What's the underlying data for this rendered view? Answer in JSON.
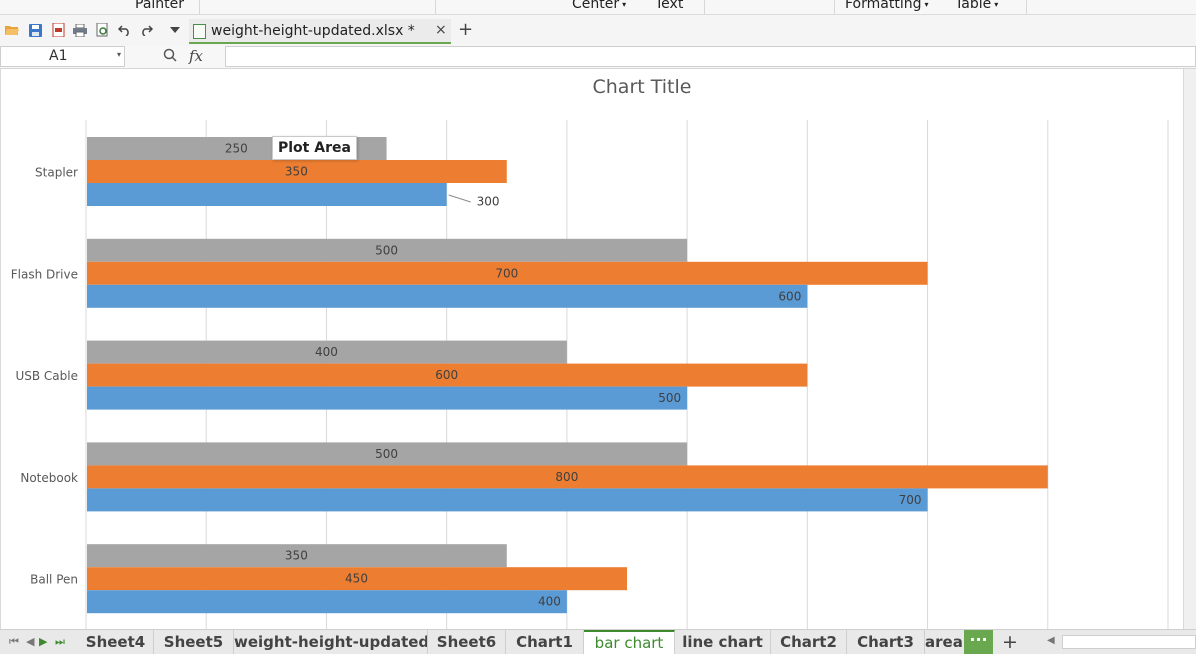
{
  "ribbon": {
    "labels": [
      "Painter",
      "Center",
      "Text",
      "Formatting",
      "Table"
    ]
  },
  "toolbar": {
    "document_tab": "weight-height-updated.xlsx *",
    "icons": [
      "open-icon",
      "save-icon",
      "export-pdf-icon",
      "print-icon",
      "print-preview-icon",
      "undo-icon",
      "redo-icon",
      "dropdown-icon"
    ]
  },
  "formula_bar": {
    "cell_ref": "A1",
    "fx_label": "fx",
    "value": ""
  },
  "chart_data": {
    "type": "bar",
    "orientation": "horizontal",
    "title": "Chart Title",
    "categories": [
      "Stapler",
      "Flash Drive",
      "USB Cable",
      "Notebook",
      "Ball Pen"
    ],
    "series": [
      {
        "values": [
          300,
          600,
          500,
          700,
          400
        ],
        "color": "#5b9bd5"
      },
      {
        "values": [
          350,
          700,
          600,
          800,
          450
        ],
        "color": "#ed7d31"
      },
      {
        "values": [
          250,
          500,
          400,
          500,
          350
        ],
        "color": "#a5a5a5"
      }
    ],
    "xlim": [
      0,
      900
    ],
    "grid": true,
    "legend": "none"
  },
  "tooltip": "Plot Area",
  "sheet_tabs": {
    "tabs": [
      "Sheet4",
      "Sheet5",
      "weight-height-updated",
      "Sheet6",
      "Chart1",
      "bar chart",
      "line chart",
      "Chart2",
      "Chart3",
      "area"
    ],
    "active": "bar chart",
    "more_label": "···",
    "add_label": "+"
  },
  "colors": {
    "accent": "#6aa84f",
    "active_tab_text": "#3d8b2e"
  }
}
